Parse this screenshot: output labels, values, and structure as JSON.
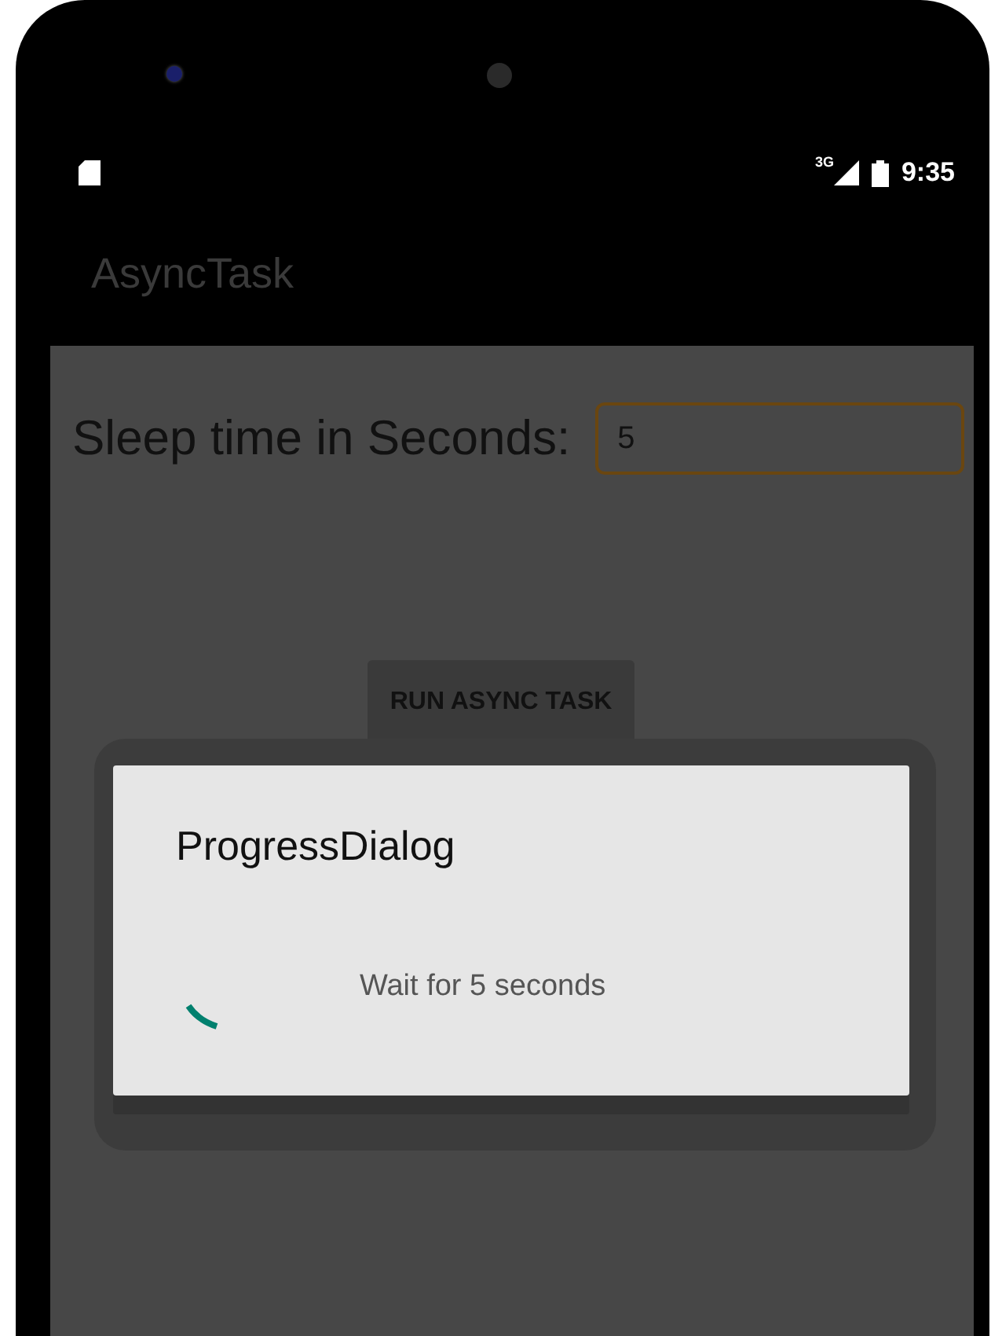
{
  "status_bar": {
    "network": "3G",
    "time": "9:35"
  },
  "app_bar": {
    "title": "AsyncTask"
  },
  "form": {
    "label": "Sleep time in Seconds:",
    "field_value": "5",
    "button": "RUN ASYNC TASK"
  },
  "dialog": {
    "title": "ProgressDialog",
    "message": "Wait for 5 seconds"
  }
}
